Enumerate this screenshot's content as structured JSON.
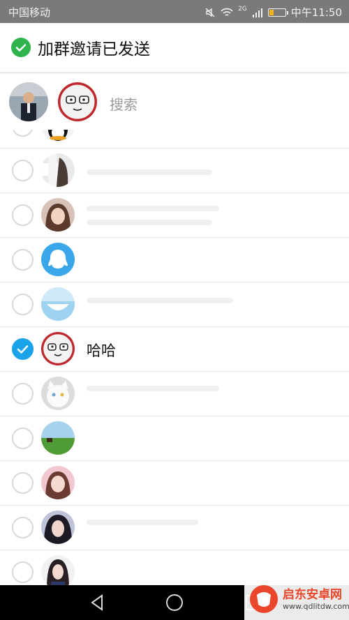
{
  "status_bar": {
    "carrier": "中国移动",
    "time": "中午11:50",
    "network_badge": "2G"
  },
  "toast": {
    "message": "加群邀请已发送",
    "icon": "check-circle-icon",
    "color": "#2fb34c"
  },
  "selected_bar": {
    "search_placeholder": "搜索",
    "selected_avatars": [
      "avatar-business-man",
      "avatar-cartoon-glasses"
    ]
  },
  "contacts": [
    {
      "name": "",
      "checked": false,
      "avatar": "penguin-avatar"
    },
    {
      "name": "",
      "checked": false,
      "avatar": "photo-avatar"
    },
    {
      "name": "",
      "checked": false,
      "avatar": "girl-photo-avatar"
    },
    {
      "name": "",
      "checked": false,
      "avatar": "qq-default-avatar"
    },
    {
      "name": "",
      "checked": false,
      "avatar": "blue-smile-avatar"
    },
    {
      "name": "哈哈",
      "checked": true,
      "avatar": "cartoon-glasses-avatar"
    },
    {
      "name": "",
      "checked": false,
      "avatar": "white-cat-avatar"
    },
    {
      "name": "",
      "checked": false,
      "avatar": "landscape-avatar"
    },
    {
      "name": "",
      "checked": false,
      "avatar": "girl-pink-avatar"
    },
    {
      "name": "",
      "checked": false,
      "avatar": "girl-dark-hair-avatar"
    },
    {
      "name": "",
      "checked": false,
      "avatar": "girl-uniform-avatar"
    }
  ],
  "navbar": {
    "back": "back-icon",
    "home": "home-icon",
    "recent": "recent-apps-icon"
  },
  "watermark": {
    "title": "启东安卓网",
    "url": "www.qdlitdw.com"
  },
  "colors": {
    "accent_blue": "#1aa3e8",
    "status_bar": "#7a7a7a"
  }
}
